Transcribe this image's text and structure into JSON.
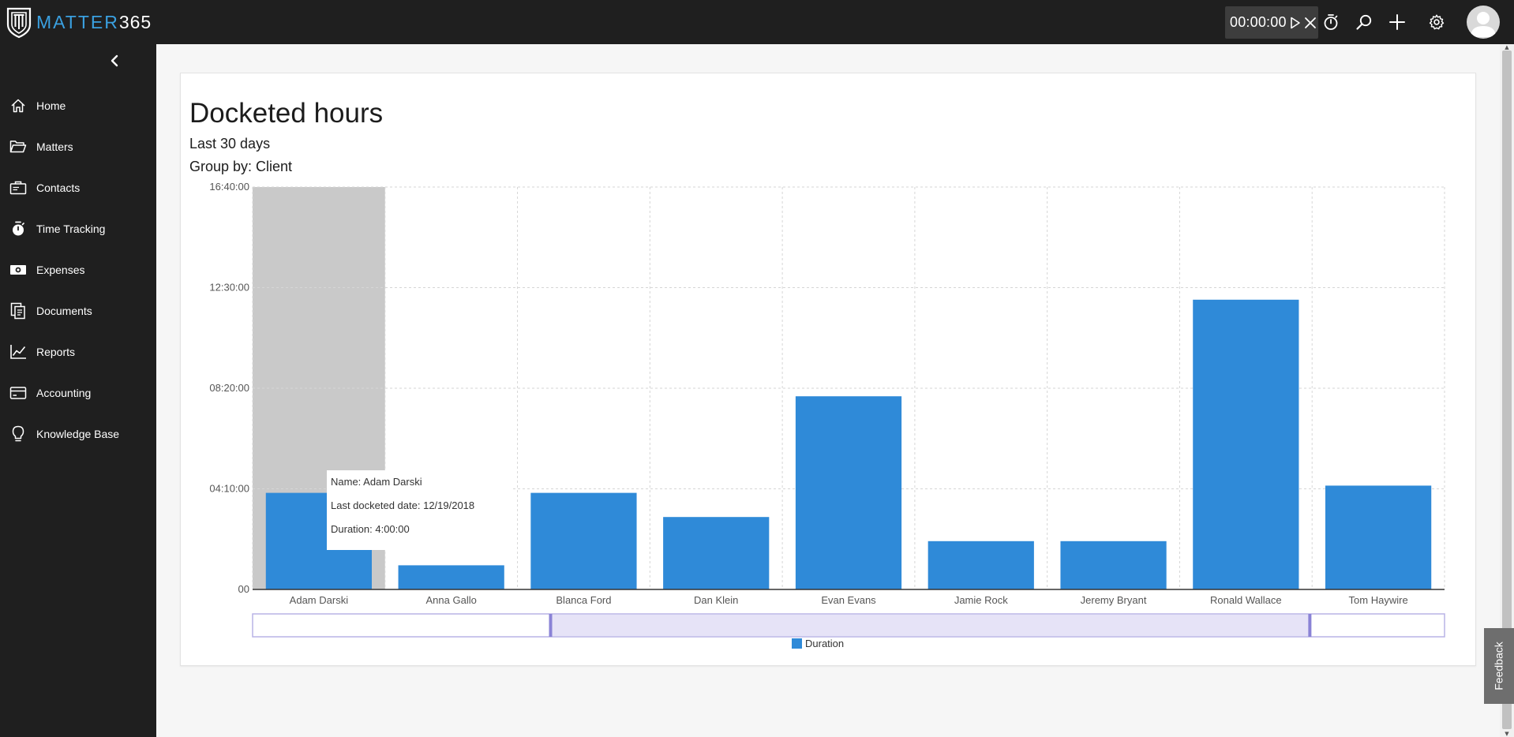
{
  "app": {
    "brand_prefix": "MATTER",
    "brand_suffix": "365"
  },
  "topbar": {
    "timer_value": "00:00:00",
    "icons": [
      "play-icon",
      "close-icon",
      "stopwatch-icon",
      "search-icon",
      "plus-icon",
      "gear-icon",
      "avatar"
    ]
  },
  "sidebar": {
    "items": [
      {
        "label": "Home",
        "icon": "home-icon"
      },
      {
        "label": "Matters",
        "icon": "folder-icon"
      },
      {
        "label": "Contacts",
        "icon": "contacts-icon"
      },
      {
        "label": "Time Tracking",
        "icon": "stopwatch-icon"
      },
      {
        "label": "Expenses",
        "icon": "money-icon"
      },
      {
        "label": "Documents",
        "icon": "documents-icon"
      },
      {
        "label": "Reports",
        "icon": "chart-icon"
      },
      {
        "label": "Accounting",
        "icon": "card-icon"
      },
      {
        "label": "Knowledge Base",
        "icon": "lightbulb-icon"
      }
    ]
  },
  "page": {
    "title": "Docketed hours",
    "subtitle": "Last 30 days",
    "group_by": "Group by: Client"
  },
  "tooltip": {
    "name": "Name: Adam Darski",
    "date": "Last docketed date: 12/19/2018",
    "duration": "Duration: 4:00:00"
  },
  "legend": {
    "label": "Duration"
  },
  "feedback": {
    "label": "Feedback"
  },
  "colors": {
    "bar": "#2f8ad8",
    "highlight": "#c9c9c9",
    "brand": "#3aa0e0"
  },
  "chart_data": {
    "type": "bar",
    "categories": [
      "Adam Darski",
      "Anna Gallo",
      "Blanca Ford",
      "Dan Klein",
      "Evan Evans",
      "Jamie Rock",
      "Jeremy Bryant",
      "Ronald Wallace",
      "Tom Haywire"
    ],
    "values_hours": [
      4.0,
      1.0,
      4.0,
      3.0,
      8.0,
      2.0,
      2.0,
      12.0,
      4.3
    ],
    "highlighted": "Adam Darski",
    "ylim_hours": [
      0,
      16.667
    ],
    "yticks": [
      {
        "value": 0,
        "label": "00"
      },
      {
        "value": 4.1667,
        "label": "04:10:00"
      },
      {
        "value": 8.3333,
        "label": "08:20:00"
      },
      {
        "value": 12.5,
        "label": "12:30:00"
      },
      {
        "value": 16.6667,
        "label": "16:40:00"
      }
    ],
    "series_name": "Duration",
    "grid": true,
    "legend_position": "bottom"
  }
}
